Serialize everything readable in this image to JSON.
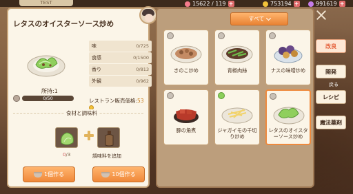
{
  "topbar": {
    "tab": "TEST",
    "stamina": "15622 / 119",
    "coins": "753194",
    "gems": "991619"
  },
  "dish": {
    "title": "レタスのオイスターソース炒め",
    "owned": "所持:1",
    "exp": "0/50",
    "price_label": "レストラン販売価格:",
    "price_value": "53",
    "stats": [
      {
        "label": "味",
        "value": "0/725"
      },
      {
        "label": "食感",
        "value": "0/1500"
      },
      {
        "label": "香り",
        "value": "0/813"
      },
      {
        "label": "外観",
        "value": "0/962"
      }
    ],
    "section": "食材と調味料",
    "ingredient_count_have": "0",
    "ingredient_count_need": "/3",
    "add_seasoning": "調味料を追加",
    "btn_1": "1個作る",
    "btn_10": "10個作る"
  },
  "recipes": {
    "filter": "すべて",
    "items": [
      {
        "name": "きのこ炒め",
        "selected": false,
        "badge": "gray"
      },
      {
        "name": "青椒肉絲",
        "selected": false,
        "badge": "gray"
      },
      {
        "name": "ナスの味噌炒め",
        "selected": false,
        "badge": "gray"
      },
      {
        "name": "豚の角煮",
        "selected": false,
        "badge": "gray"
      },
      {
        "name": "ジャガイモの千切り炒め",
        "selected": false,
        "badge": "green"
      },
      {
        "name": "レタスのオイスターソース炒め",
        "selected": true,
        "badge": "gray"
      }
    ]
  },
  "sidebar": {
    "improve": "改良",
    "develop": "開発",
    "back": "戻る",
    "recipe": "レシピ",
    "magic": "魔法薬剤"
  },
  "colors": {
    "accent": "#ee8a3e",
    "panel": "#fbf5e8"
  }
}
